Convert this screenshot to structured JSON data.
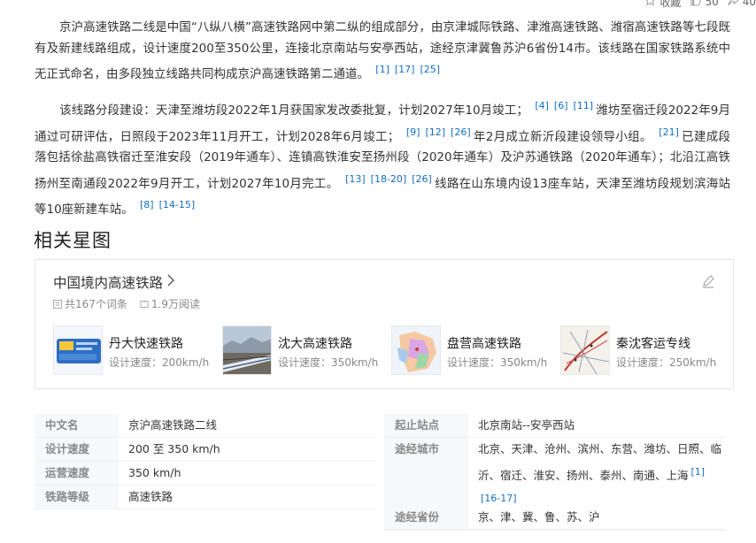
{
  "topbar": {
    "collect_label": "收藏",
    "like_count": "50",
    "share_count": "40"
  },
  "para1": {
    "text": "京沪高速铁路二线是中国“八纵八横”高速铁路网中第二纵的组成部分，由京津城际铁路、津潍高速铁路、潍宿高速铁路等七段既有及新建线路组成，设计速度200至350公里，连接北京南站与安亭西站，途经京津冀鲁苏沪6省份14市。该线路在国家铁路系统中无正式命名，由多段独立线路共同构成京沪高速铁路第二通道。",
    "refs": [
      "[1]",
      "[17]",
      "[25]"
    ]
  },
  "para2": {
    "s1": "该线路分段建设：天津至潍坊段2022年1月获国家发改委批复，计划2027年10月竣工；",
    "refs1": [
      "[4]",
      "[6]",
      "[11]"
    ],
    "s2": "潍坊至宿迁段2022年9月通过可研评估，日照段于2023年11月开工，计划2028年6月竣工；",
    "refs2": [
      "[9]",
      "[12]",
      "[26]"
    ],
    "s3": "年2月成立新沂段建设领导小组。",
    "refs3": [
      "[21]"
    ],
    "s4": "已建成段落包括徐盐高铁宿迁至淮安段（2019年通车）、连镇高铁淮安至扬州段（2020年通车）及沪苏通铁路（2020年通车）；北沿江高铁扬州至南通段2022年9月开工，计划2027年10月完工。",
    "refs4": [
      "[13]",
      "[18-20]",
      "[26]"
    ],
    "s5": "线路在山东境内设13座车站，天津至潍坊段规划滨海站等10座新建车站。",
    "refs5": [
      "[8]",
      "[14-15]"
    ]
  },
  "section_title": "相关星图",
  "star_card": {
    "title": "中国境内高速铁路",
    "entries": "共167个词条",
    "reads": "1.9万阅读",
    "rails": [
      {
        "name": "丹大快速铁路",
        "speed": "设计速度：200km/h"
      },
      {
        "name": "沈大高速铁路",
        "speed": "设计速度：350km/h"
      },
      {
        "name": "盘营高速铁路",
        "speed": "设计速度：350km/h"
      },
      {
        "name": "秦沈客运专线",
        "speed": "设计速度：250km/h"
      }
    ]
  },
  "basic_info": {
    "left": [
      {
        "key": "中文名",
        "value": "京沪高速铁路二线"
      },
      {
        "key": "设计速度",
        "value": "200 至 350 km/h"
      },
      {
        "key": "运营速度",
        "value": "350 km/h"
      },
      {
        "key": "铁路等级",
        "value": "高速铁路"
      }
    ],
    "right": {
      "start_key": "起止站点",
      "start_value": "北京南站--安亭西站",
      "cities_key": "途经城市",
      "cities_line1": "北京、天津、沧州、滨州、东营、潍坊、日照、临",
      "cities_line2": "沂、宿迁、淮安、扬州、泰州、南通、上海",
      "cities_ref1": "[1]",
      "cities_ref2": "[16-17]",
      "prov_key": "途经省份",
      "prov_value": "京、津、冀、鲁、苏、沪"
    }
  }
}
